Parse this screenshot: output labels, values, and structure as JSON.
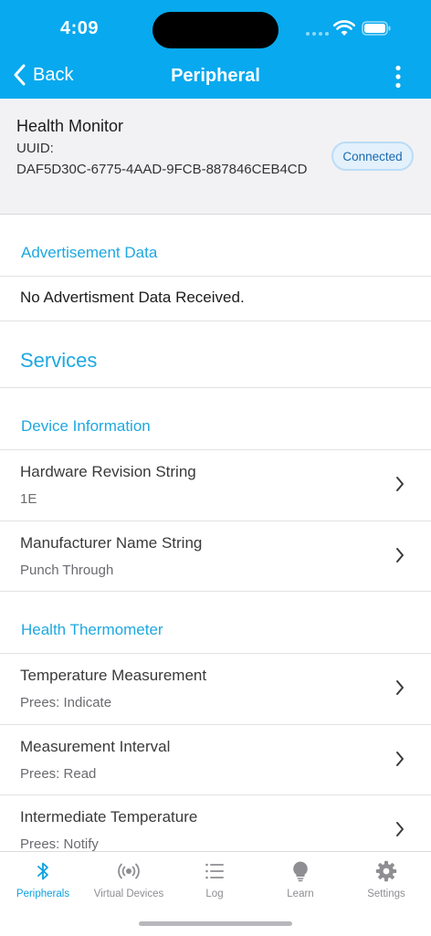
{
  "status_bar": {
    "time": "4:09"
  },
  "nav": {
    "back_label": "Back",
    "title": "Peripheral"
  },
  "device": {
    "name": "Health Monitor",
    "uuid_label": "UUID:",
    "uuid": "DAF5D30C-6775-4AAD-9FCB-887846CEB4CD",
    "status": "Connected"
  },
  "advertisement": {
    "header": "Advertisement Data",
    "empty_text": "No Advertisment Data Received."
  },
  "services": {
    "title": "Services",
    "groups": [
      {
        "header": "Device Information",
        "items": [
          {
            "title": "Hardware Revision String",
            "subtitle": "1E"
          },
          {
            "title": "Manufacturer Name String",
            "subtitle": "Punch Through"
          }
        ]
      },
      {
        "header": "Health Thermometer",
        "items": [
          {
            "title": "Temperature Measurement",
            "subtitle": "Prees: Indicate"
          },
          {
            "title": "Measurement Interval",
            "subtitle": "Prees: Read"
          },
          {
            "title": "Intermediate Temperature",
            "subtitle": "Prees: Notify"
          }
        ]
      }
    ]
  },
  "tabs": [
    {
      "label": "Peripherals",
      "icon": "bluetooth-icon",
      "active": true
    },
    {
      "label": "Virtual Devices",
      "icon": "broadcast-icon",
      "active": false
    },
    {
      "label": "Log",
      "icon": "list-icon",
      "active": false
    },
    {
      "label": "Learn",
      "icon": "lightbulb-icon",
      "active": false
    },
    {
      "label": "Settings",
      "icon": "gear-icon",
      "active": false
    }
  ],
  "colors": {
    "accent": "#08a9ee",
    "section_text": "#1ea8e0",
    "badge_background": "#e3f1fc",
    "badge_text": "#1a69b0"
  }
}
